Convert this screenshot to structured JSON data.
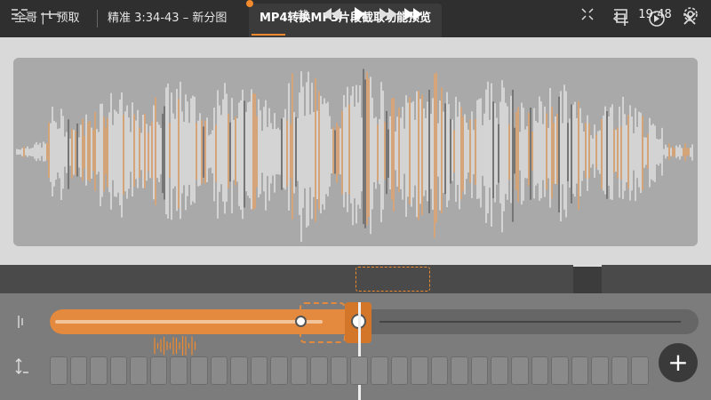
{
  "tabs": [
    {
      "label": "全哥 | - 预取"
    },
    {
      "label": "精准 3:34-43 – 新分图"
    },
    {
      "label": "MP4转换MP3片段截取功能预览"
    }
  ],
  "toolbar": {
    "icons": [
      "crop-icon",
      "forward-circle-icon",
      "close-icon"
    ]
  },
  "controls": {
    "cut_label": "裁",
    "time": "19:48",
    "icons": [
      "menu-icon",
      "split-icon",
      "rewind-icon",
      "play-icon",
      "fast-forward-icon",
      "skip-forward-icon",
      "fit-icon",
      "loop-icon",
      "settings-icon"
    ]
  },
  "timeline": {
    "playhead_fraction": 0.475,
    "selection_fraction": 0.495,
    "add_label": "+"
  },
  "colors": {
    "accent": "#f08a2c",
    "waveform_light": "#f0f0f0",
    "waveform_accent": "#f2a25a",
    "waveform_dark": "#555555"
  }
}
